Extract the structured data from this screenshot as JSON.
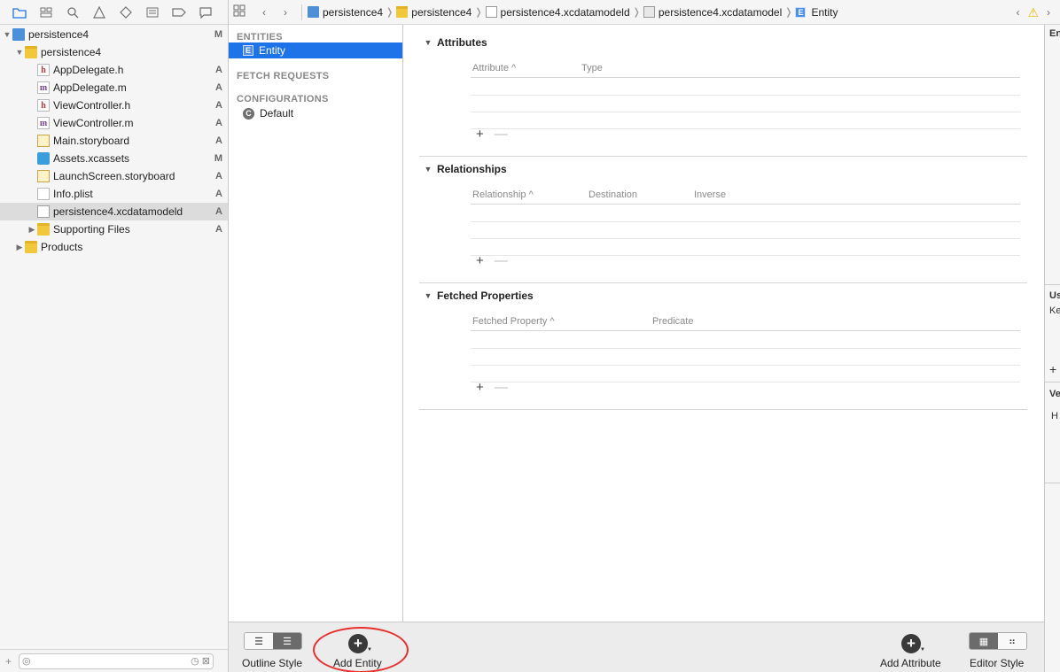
{
  "navigator": {
    "tree": [
      {
        "label": "persistence4",
        "status": "M",
        "icon": "project-icon",
        "depth": 0,
        "disclosure": "open"
      },
      {
        "label": "persistence4",
        "status": "",
        "icon": "folder-icon",
        "depth": 1,
        "disclosure": "open"
      },
      {
        "label": "AppDelegate.h",
        "status": "A",
        "icon": "header-file-icon",
        "depth": 2
      },
      {
        "label": "AppDelegate.m",
        "status": "A",
        "icon": "source-file-icon",
        "depth": 2
      },
      {
        "label": "ViewController.h",
        "status": "A",
        "icon": "header-file-icon",
        "depth": 2
      },
      {
        "label": "ViewController.m",
        "status": "A",
        "icon": "source-file-icon",
        "depth": 2
      },
      {
        "label": "Main.storyboard",
        "status": "A",
        "icon": "storyboard-icon",
        "depth": 2
      },
      {
        "label": "Assets.xcassets",
        "status": "M",
        "icon": "assets-icon",
        "depth": 2
      },
      {
        "label": "LaunchScreen.storyboard",
        "status": "A",
        "icon": "storyboard-icon",
        "depth": 2
      },
      {
        "label": "Info.plist",
        "status": "A",
        "icon": "plist-icon",
        "depth": 2
      },
      {
        "label": "persistence4.xcdatamodeld",
        "status": "A",
        "icon": "data-model-icon",
        "depth": 2,
        "selected": true
      },
      {
        "label": "Supporting Files",
        "status": "A",
        "icon": "folder-icon",
        "depth": 2,
        "disclosure": "closed"
      },
      {
        "label": "Products",
        "status": "",
        "icon": "folder-icon",
        "depth": 1,
        "disclosure": "closed"
      }
    ]
  },
  "jumpbar": {
    "crumbs": [
      "persistence4",
      "persistence4",
      "persistence4.xcdatamodeld",
      "persistence4.xcdatamodel",
      "Entity"
    ]
  },
  "model_list": {
    "entities_header": "ENTITIES",
    "entity_item": "Entity",
    "entity_badge": "E",
    "fetch_header": "FETCH REQUESTS",
    "config_header": "CONFIGURATIONS",
    "config_item": "Default",
    "config_badge": "C"
  },
  "editor": {
    "attributes": {
      "title": "Attributes",
      "col1": "Attribute ^",
      "col2": "Type"
    },
    "relationships": {
      "title": "Relationships",
      "col1": "Relationship ^",
      "col2": "Destination",
      "col3": "Inverse"
    },
    "fetched": {
      "title": "Fetched Properties",
      "col1": "Fetched Property ^",
      "col2": "Predicate"
    },
    "plus": "+",
    "minus": "—"
  },
  "inspector": {
    "label1": "En",
    "label2": "Us",
    "label3": "Ke",
    "label4": "Ve",
    "label5": "H"
  },
  "bottombar": {
    "outline_style": "Outline Style",
    "add_entity": "Add Entity",
    "add_attribute": "Add Attribute",
    "editor_style": "Editor Style"
  },
  "colors": {
    "selection": "#1e73e8",
    "highlight_oval": "#e8302f"
  }
}
